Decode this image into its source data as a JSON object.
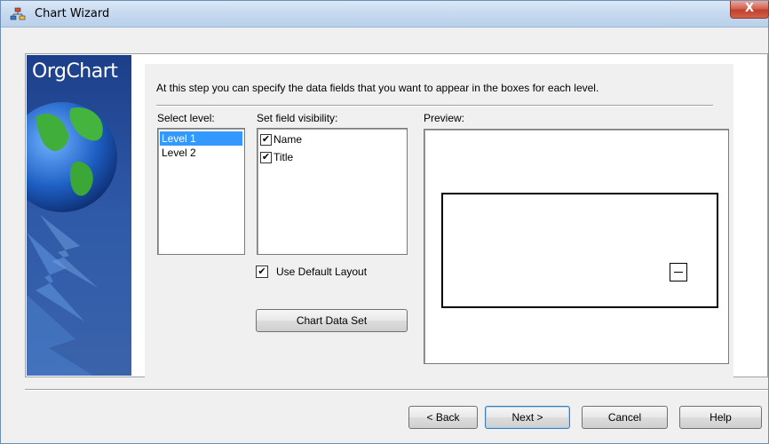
{
  "window": {
    "title": "Chart Wizard",
    "close_label": "X"
  },
  "banner": {
    "title": "OrgChart"
  },
  "wizard": {
    "instruction": "At this step you can specify the data fields that you want to appear in the boxes for each level.",
    "select_level_label": "Select level:",
    "levels": [
      {
        "label": "Level 1",
        "selected": true
      },
      {
        "label": "Level 2",
        "selected": false
      }
    ],
    "field_visibility_label": "Set field visibility:",
    "fields": [
      {
        "label": "Name",
        "checked": true
      },
      {
        "label": "Title",
        "checked": true
      }
    ],
    "preview_label": "Preview:",
    "use_default_layout": {
      "label": "Use Default Layout",
      "checked": true
    },
    "chart_data_set_label": "Chart Data Set"
  },
  "footer": {
    "back_label": "< Back",
    "next_label": "Next >",
    "cancel_label": "Cancel",
    "help_label": "Help"
  },
  "colors": {
    "selection": "#3399ff",
    "banner_blue": "#2f5aa8"
  }
}
